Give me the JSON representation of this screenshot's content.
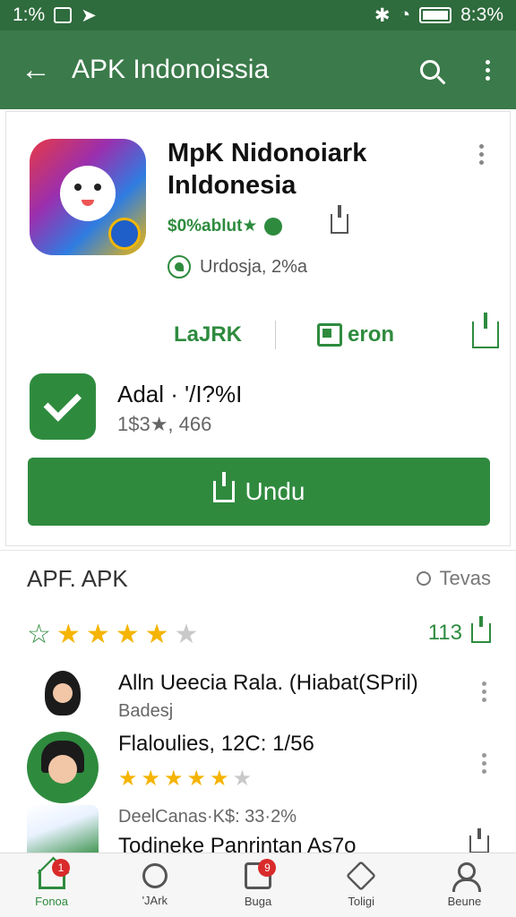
{
  "status_bar": {
    "time": "1:%",
    "battery": "8:3%"
  },
  "app_bar": {
    "title": "APK Indonoissia"
  },
  "app": {
    "name": "MpK Nidonoiark Inldonesia",
    "developer": "$0%ablut★",
    "location": "Urdosja, 2%a"
  },
  "actions": {
    "lark_label": "LaJRK",
    "beron_label": "eron"
  },
  "verified": {
    "title": "Adal · '/I?%I",
    "subtitle": "1$3★, 466"
  },
  "install": {
    "label": "Undu"
  },
  "reviews": {
    "heading": "APF. APK",
    "toggle_label": "Tevas",
    "rating": 4,
    "max_rating": 5,
    "count": "113",
    "items": [
      {
        "title": "Alln Ueecia Rala. (Hiabat(SPril)",
        "subtitle": "Badesj"
      },
      {
        "title": "Flaloulies, 12C: 1/56",
        "rating": 5.5
      },
      {
        "subtitle_prefix": "DeelCanas·K$: 33·2%",
        "title": "Todineke Panrintan As7o"
      }
    ]
  },
  "bottom_nav": {
    "items": [
      {
        "label": "Fonoa",
        "badge": "1"
      },
      {
        "label": "'JArk",
        "badge": ""
      },
      {
        "label": "Buga",
        "badge": "9"
      },
      {
        "label": "Toligi",
        "badge": ""
      },
      {
        "label": "Beune",
        "badge": ""
      }
    ]
  },
  "colors": {
    "brand": "#3b7a4a",
    "accent": "#2e8b3e",
    "star": "#f5b400",
    "badge": "#d92b2b"
  }
}
